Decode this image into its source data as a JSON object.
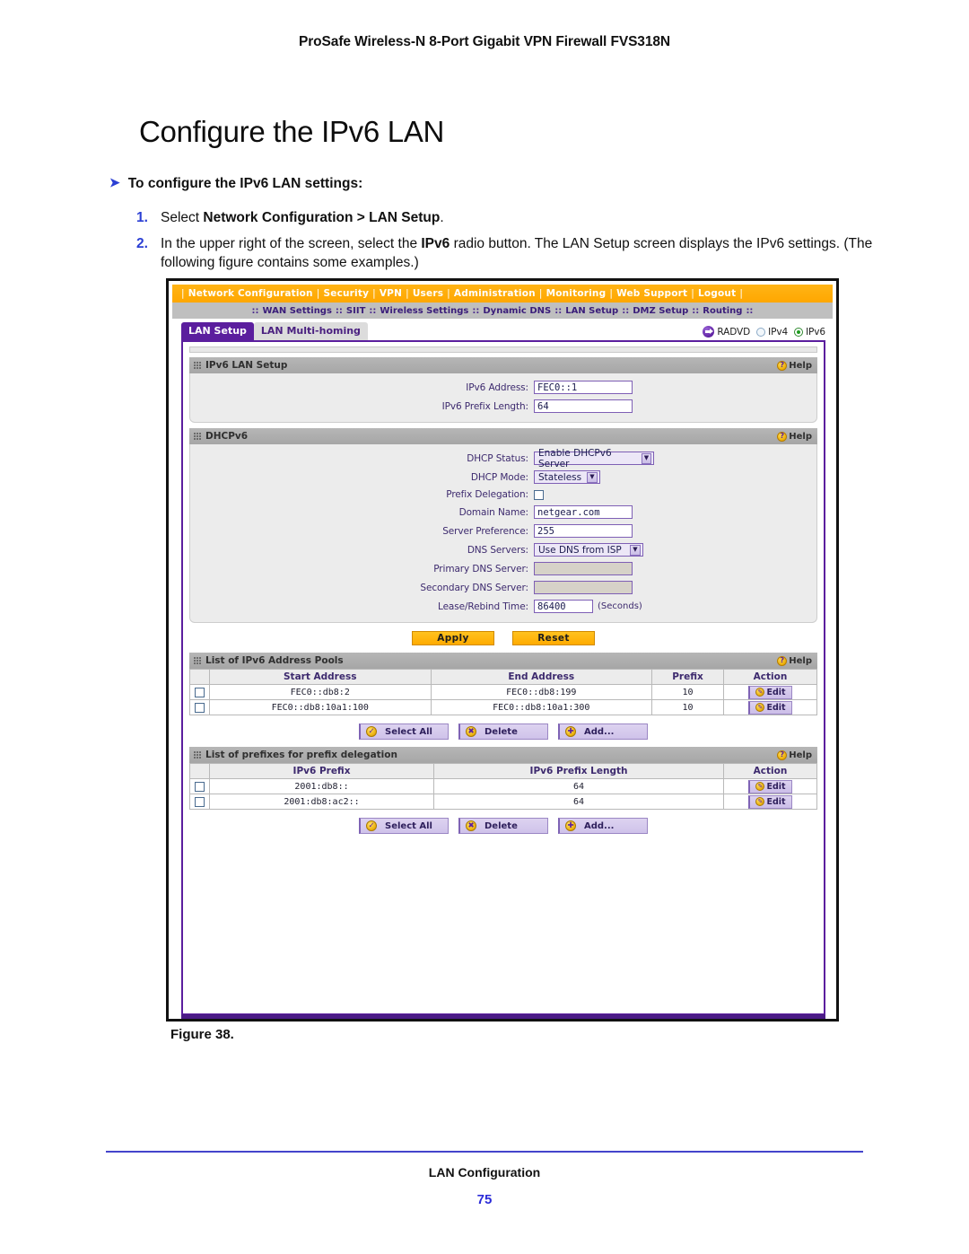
{
  "page": {
    "running_head": "ProSafe Wireless-N 8-Port Gigabit VPN Firewall FVS318N",
    "title": "Configure the IPv6 LAN",
    "procedure_heading": "To configure the IPv6 LAN settings:",
    "steps": [
      {
        "num": "1.",
        "text_pre": "Select ",
        "text_bold": "Network Configuration > LAN Setup",
        "text_post": "."
      },
      {
        "num": "2.",
        "text_pre": "In the upper right of the screen, select the ",
        "text_bold": "IPv6",
        "text_post": " radio button. The LAN Setup screen displays the IPv6 settings. (The following figure contains some examples.)"
      }
    ],
    "figure_caption": "Figure 38.",
    "footer_title": "LAN Configuration",
    "footer_page": "75"
  },
  "colors": {
    "navbar_orange": "#ffa700",
    "purple": "#5b1e9e",
    "subnav_gray": "#bfbfbf",
    "gold_button": "#ffab00",
    "lilac_button": "#cfc2ea",
    "link_blue": "#2b3fd4"
  },
  "ui": {
    "navbar": {
      "items": [
        "Network Configuration",
        "Security",
        "VPN",
        "Users",
        "Administration",
        "Monitoring",
        "Web Support",
        "Logout"
      ]
    },
    "subnav": {
      "items": [
        "WAN Settings",
        "SIIT",
        "Wireless Settings",
        "Dynamic DNS",
        "LAN Setup",
        "DMZ Setup",
        "Routing"
      ]
    },
    "tabs": [
      {
        "label": "LAN Setup",
        "active": true
      },
      {
        "label": "LAN Multi-homing",
        "active": false
      }
    ],
    "mode_selector": {
      "radvd_label": "RADVD",
      "ipv4_label": "IPv4",
      "ipv6_label": "IPv6",
      "selected": "IPv6"
    },
    "help_label": "Help",
    "sections": {
      "ipv6_lan_setup": {
        "title": "IPv6 LAN Setup",
        "fields": [
          {
            "label": "IPv6 Address:",
            "value": "FEC0::1",
            "type": "text"
          },
          {
            "label": "IPv6 Prefix Length:",
            "value": "64",
            "type": "text"
          }
        ]
      },
      "dhcpv6": {
        "title": "DHCPv6",
        "fields": [
          {
            "label": "DHCP Status:",
            "value": "Enable DHCPv6 Server",
            "type": "select"
          },
          {
            "label": "DHCP Mode:",
            "value": "Stateless",
            "type": "select"
          },
          {
            "label": "Prefix Delegation:",
            "value": "",
            "type": "checkbox",
            "checked": false
          },
          {
            "label": "Domain Name:",
            "value": "netgear.com",
            "type": "text"
          },
          {
            "label": "Server Preference:",
            "value": "255",
            "type": "text"
          },
          {
            "label": "DNS Servers:",
            "value": "Use DNS from ISP",
            "type": "select"
          },
          {
            "label": "Primary DNS Server:",
            "value": "",
            "type": "text",
            "disabled": true
          },
          {
            "label": "Secondary DNS Server:",
            "value": "",
            "type": "text",
            "disabled": true
          },
          {
            "label": "Lease/Rebind Time:",
            "value": "86400",
            "type": "text",
            "unit": "(Seconds)"
          }
        ]
      },
      "address_pools": {
        "title": "List of IPv6 Address Pools",
        "columns": [
          "Start Address",
          "End Address",
          "Prefix",
          "Action"
        ],
        "rows": [
          {
            "start": "FEC0::db8:2",
            "end": "FEC0::db8:199",
            "prefix": "10",
            "action": "Edit"
          },
          {
            "start": "FEC0::db8:10a1:100",
            "end": "FEC0::db8:10a1:300",
            "prefix": "10",
            "action": "Edit"
          }
        ]
      },
      "prefix_delegation": {
        "title": "List of prefixes for prefix delegation",
        "columns": [
          "IPv6 Prefix",
          "IPv6 Prefix Length",
          "Action"
        ],
        "rows": [
          {
            "prefix": "2001:db8::",
            "length": "64",
            "action": "Edit"
          },
          {
            "prefix": "2001:db8:ac2::",
            "length": "64",
            "action": "Edit"
          }
        ]
      }
    },
    "buttons": {
      "apply": "Apply",
      "reset": "Reset",
      "select_all": "Select All",
      "delete": "Delete",
      "add": "Add..."
    }
  }
}
